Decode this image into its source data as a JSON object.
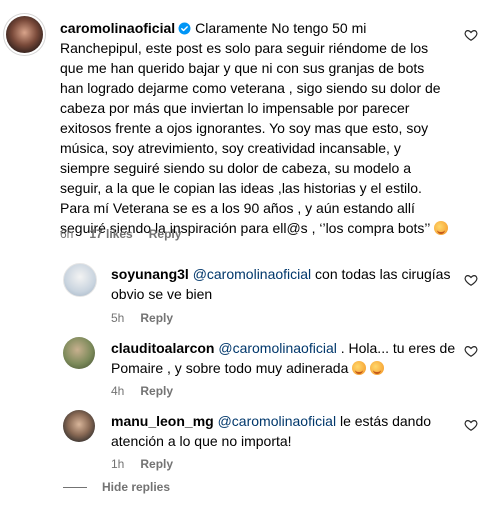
{
  "colors": {
    "mention": "#00376b",
    "meta": "#737373",
    "verified": "#0095f6"
  },
  "comments": [
    {
      "username": "caromolinaoficial",
      "verified": true,
      "text": "Claramente No tengo 50 mi Ranchepipul, este post es solo para seguir riéndome de los que me han querido bajar y que ni con sus granjas de bots han logrado dejarme como veterana , sigo siendo su dolor de cabeza por más que inviertan lo impensable por parecer exitosos frente a ojos ignorantes. Yo soy mas que esto, soy música, soy atrevimiento, soy creatividad incansable, y siempre seguiré siendo su dolor de cabeza, su modelo a seguir, a la que le copian las ideas ,las historias y el estilo.",
      "text2": "Para mí Veterana se es a los 90 años , y aún estando allí seguiré siendo la inspiración para ell@s , ‘’los compra bots’’",
      "time": "6h",
      "likes": "17 likes",
      "reply": "Reply"
    },
    {
      "username": "soyunang3l",
      "mention": "@caromolinaoficial",
      "text": " con todas las cirugías obvio se ve bien",
      "time": "5h",
      "reply": "Reply"
    },
    {
      "username": "clauditoalarcon",
      "mention": "@caromolinaoficial",
      "text": " . Hola... tu eres de Pomaire , y sobre todo muy adinerada",
      "time": "4h",
      "reply": "Reply"
    },
    {
      "username": "manu_leon_mg",
      "mention": "@caromolinaoficial",
      "text": " le estás dando atención a lo que no importa!",
      "time": "1h",
      "reply": "Reply"
    }
  ],
  "hide_replies": "Hide replies"
}
